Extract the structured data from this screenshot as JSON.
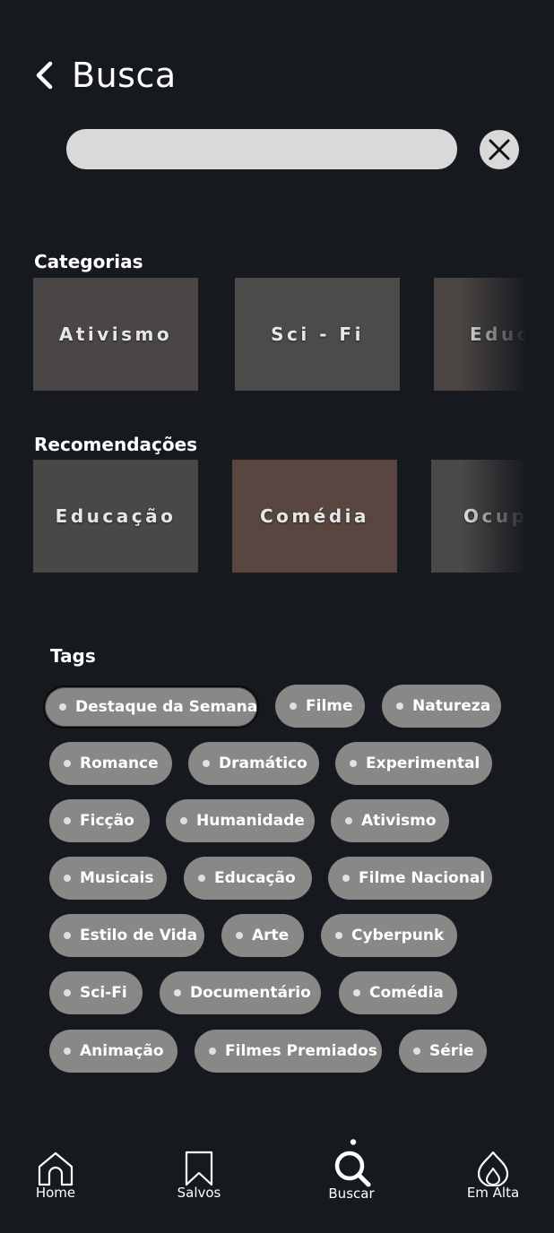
{
  "header": {
    "title": "Busca"
  },
  "search": {
    "value": "",
    "placeholder": ""
  },
  "categories": {
    "title": "Categorias",
    "items": [
      {
        "label": "Ativismo",
        "bg": "#4a4646"
      },
      {
        "label": "Sci - Fi",
        "bg": "#4d4a4a"
      },
      {
        "label": "Educ",
        "bg": "#4a4543"
      }
    ]
  },
  "recommendations": {
    "title": "Recomendações",
    "items": [
      {
        "label": "Educação",
        "bg": "#4a4747"
      },
      {
        "label": "Comédia",
        "bg": "#5a4640"
      },
      {
        "label": "Ocup",
        "bg": "#4b4848"
      }
    ]
  },
  "tags": {
    "title": "Tags",
    "items": [
      "Destaque da Semana",
      "Filme",
      "Natureza",
      "Romance",
      "Dramático",
      "Experimental",
      "Ficção",
      "Humanidade",
      "Ativismo",
      "Musicais",
      "Educação",
      "Filme Nacional",
      "Estilo de Vida",
      "Arte",
      "Cyberpunk",
      "Sci-Fi",
      "Documentário",
      "Comédia",
      "Animação",
      "Filmes Premiados",
      "Série"
    ]
  },
  "nav": {
    "home": "Home",
    "saved": "Salvos",
    "search": "Buscar",
    "trending": "Em Alta"
  },
  "colors": {
    "background": "#16191e",
    "tag": "#8a8787",
    "input": "#d9d9d9"
  }
}
